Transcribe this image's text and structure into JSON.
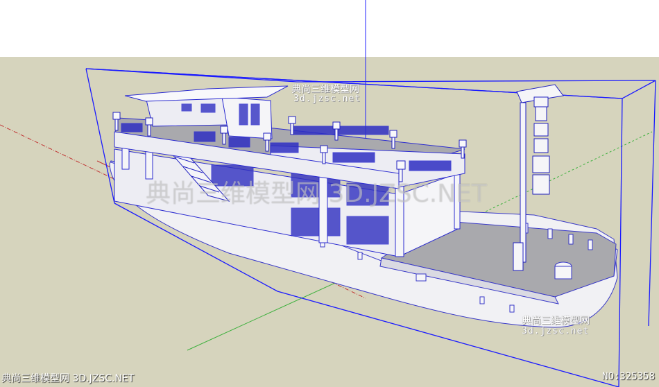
{
  "watermarks": {
    "top_cn": "典尚三维模型网",
    "top_url": "3d.jzsc.net",
    "center": "典尚三维模型网 3D.JZSC.NET",
    "bottom_right_cn": "典尚三维模型网",
    "bottom_right_url": "3d.jzsc.net"
  },
  "footer": {
    "site": "典尚三维模型网 3D.JZSC.NET",
    "model_no": "NO:325358"
  },
  "colors": {
    "sky": "#ffffff",
    "ground": "#d6d4bd",
    "selection": "#1a1aff",
    "axis_red": "#c03030",
    "axis_green": "#3db03d",
    "axis_blue": "#2020ff",
    "model_fill": "#ececf2",
    "deck_fill": "#a9a9ad"
  }
}
